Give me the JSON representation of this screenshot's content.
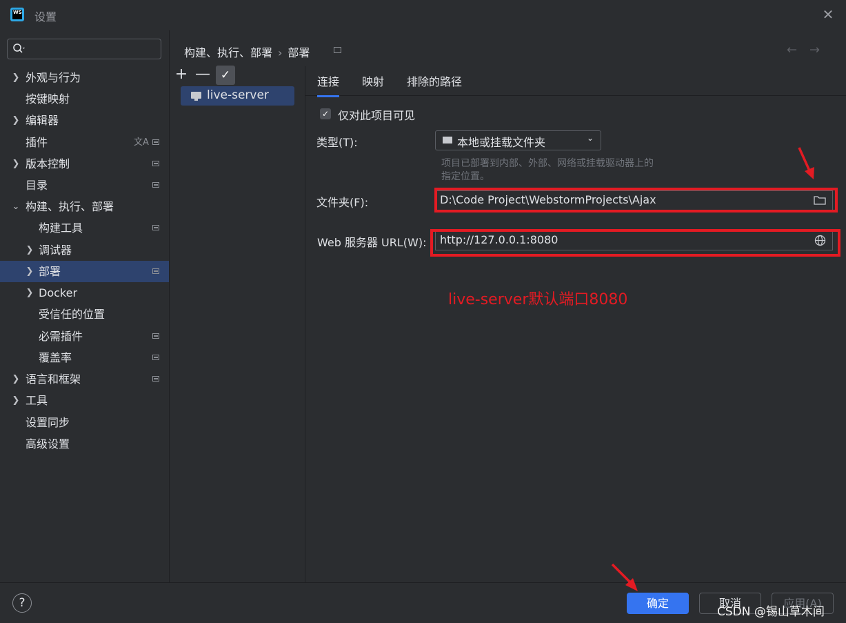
{
  "window": {
    "title": "设置",
    "logo_text": "WS"
  },
  "search": {
    "placeholder": ""
  },
  "sidebar": {
    "items": [
      {
        "label": "外观与行为"
      },
      {
        "label": "按键映射"
      },
      {
        "label": "编辑器"
      },
      {
        "label": "插件"
      },
      {
        "label": "版本控制"
      },
      {
        "label": "目录"
      },
      {
        "label": "构建、执行、部署"
      },
      {
        "label": "构建工具"
      },
      {
        "label": "调试器"
      },
      {
        "label": "部署",
        "selected": true
      },
      {
        "label": "Docker"
      },
      {
        "label": "受信任的位置"
      },
      {
        "label": "必需插件"
      },
      {
        "label": "覆盖率"
      },
      {
        "label": "语言和框架"
      },
      {
        "label": "工具"
      },
      {
        "label": "设置同步"
      },
      {
        "label": "高级设置"
      }
    ]
  },
  "breadcrumb": {
    "parent": "构建、执行、部署",
    "current": "部署"
  },
  "toolbar": {
    "add": "+",
    "remove": "—",
    "check": "✓"
  },
  "servers": [
    {
      "name": "live-server"
    }
  ],
  "tabs": [
    {
      "label": "连接"
    },
    {
      "label": "映射"
    },
    {
      "label": "排除的路径"
    }
  ],
  "form": {
    "visible_only_label": "仅对此项目可见",
    "type_label": "类型(T):",
    "type_value": "本地或挂载文件夹",
    "hint_line1": "项目已部署到内部、外部、网络或挂载驱动器上的",
    "hint_line2": "指定位置。",
    "folder_label": "文件夹(F):",
    "folder_value": "D:\\Code Project\\WebstormProjects\\Ajax",
    "url_label": "Web 服务器 URL(W):",
    "url_value": "http://127.0.0.1:8080"
  },
  "annotation": {
    "text": "live-server默认端口8080",
    "color": "#e31b23"
  },
  "footer": {
    "help": "?",
    "ok": "确定",
    "cancel": "取消",
    "apply": "应用(A)",
    "watermark": "CSDN @锡山草木间"
  },
  "colors": {
    "accent": "#3574f0",
    "selection": "#2e436e",
    "annotation_red": "#e31b23"
  }
}
